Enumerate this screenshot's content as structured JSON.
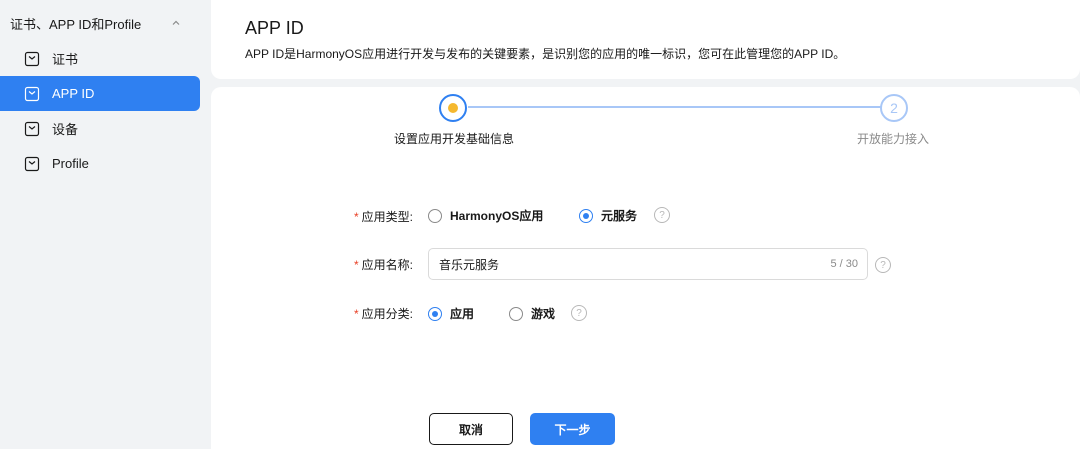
{
  "sidebar": {
    "group_label": "证书、APP ID和Profile",
    "items": [
      {
        "label": "证书",
        "icon": "certificate-icon"
      },
      {
        "label": "APP ID",
        "icon": "appid-icon",
        "active": true
      },
      {
        "label": "设备",
        "icon": "device-icon"
      },
      {
        "label": "Profile",
        "icon": "profile-icon"
      }
    ]
  },
  "header": {
    "title": "APP ID",
    "description": "APP ID是HarmonyOS应用进行开发与发布的关键要素，是识别您的应用的唯一标识，您可在此管理您的APP ID。"
  },
  "steps": [
    {
      "label": "设置应用开发基础信息",
      "state": "current"
    },
    {
      "number": "2",
      "label": "开放能力接入",
      "state": "pending"
    }
  ],
  "form": {
    "app_type": {
      "label": "应用类型:",
      "options": [
        "HarmonyOS应用",
        "元服务"
      ],
      "selected": "元服务"
    },
    "app_name": {
      "label": "应用名称:",
      "value": "音乐元服务",
      "count": "5 / 30"
    },
    "app_category": {
      "label": "应用分类:",
      "options": [
        "应用",
        "游戏"
      ],
      "selected": "应用"
    },
    "help_glyph": "?"
  },
  "buttons": {
    "cancel": "取消",
    "next": "下一步"
  },
  "colors": {
    "accent": "#2f80f1",
    "step_dot": "#f5b82e",
    "required": "#e84026"
  }
}
